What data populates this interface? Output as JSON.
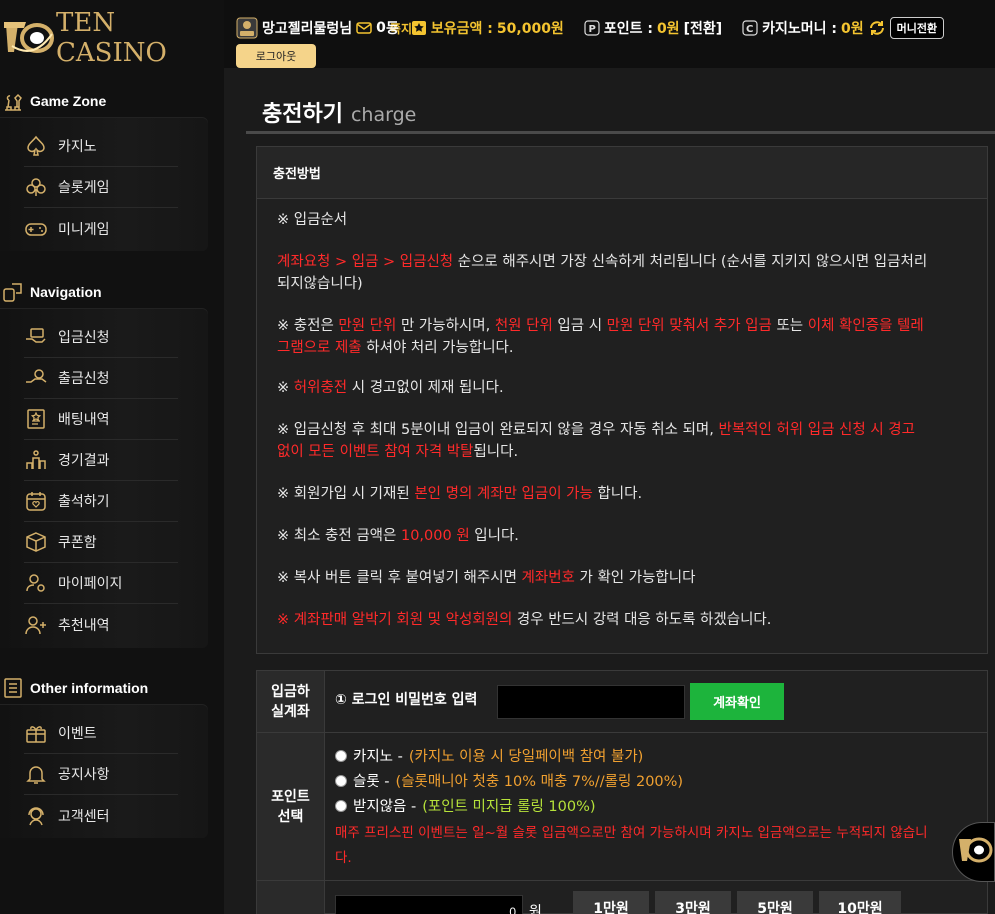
{
  "brand": {
    "name": "TEN CASINO"
  },
  "user": {
    "name": "망고젤리물렁님",
    "message_count": "0",
    "message_label": "쪽지",
    "mini_label": "등",
    "balance_label": "보유금액 :",
    "balance_value": "50,000원",
    "points_label": "포인트 :",
    "points_value": "0원",
    "points_convert": "[전환]",
    "casino_money_label": "카지노머니 :",
    "casino_money_value": "0원",
    "money_transfer": "머니전환",
    "logout": "로그아웃"
  },
  "sidebar": {
    "sections": [
      {
        "title": "Game Zone",
        "items": [
          {
            "label": "카지노",
            "icon": "spade-icon"
          },
          {
            "label": "슬롯게임",
            "icon": "club-icon"
          },
          {
            "label": "미니게임",
            "icon": "gamepad-icon"
          }
        ]
      },
      {
        "title": "Navigation",
        "items": [
          {
            "label": "입금신청",
            "icon": "deposit-icon"
          },
          {
            "label": "출금신청",
            "icon": "withdraw-icon"
          },
          {
            "label": "배팅내역",
            "icon": "betting-history-icon"
          },
          {
            "label": "경기결과",
            "icon": "results-icon"
          },
          {
            "label": "출석하기",
            "icon": "calendar-icon"
          },
          {
            "label": "쿠폰함",
            "icon": "coupon-box-icon"
          },
          {
            "label": "마이페이지",
            "icon": "user-settings-icon"
          },
          {
            "label": "추천내역",
            "icon": "referral-icon"
          }
        ]
      },
      {
        "title": "Other information",
        "items": [
          {
            "label": "이벤트",
            "icon": "gift-icon"
          },
          {
            "label": "공지사항",
            "icon": "bell-icon"
          },
          {
            "label": "고객센터",
            "icon": "support-icon"
          }
        ]
      }
    ]
  },
  "page": {
    "title_ko": "충전하기",
    "title_en": "charge"
  },
  "panel": {
    "heading": "충전방법",
    "order_title": "※ 입금순서",
    "n1a": "계좌요청 > 입금 > 입금신청",
    "n1b": " 순으로 해주시면 가장 신속하게 처리됩니다 (순서를 지키지 않으시면 입금처리",
    "n1c": "되지않습니다)",
    "n2a": "※ 충전은 ",
    "n2b": "만원 단위",
    "n2c": " 만 가능하시며, ",
    "n2d": "천원 단위",
    "n2e": " 입금 시 ",
    "n2f": "만원 단위 맞춰서 추가 입금",
    "n2g": " 또는 ",
    "n2h": "이체 확인증을 텔레",
    "n2i": "그램으로 제출",
    "n2j": " 하셔야 처리 가능합니다.",
    "n3a": "※ ",
    "n3b": "허위충전",
    "n3c": " 시 경고없이 제재 됩니다.",
    "n4a": "※ 입금신청 후 최대 5분이내 입금이 완료되지 않을 경우 자동 취소 되며, ",
    "n4b": "반복적인 허위 입금 신청 시 경고",
    "n4c": "없이 모든 이벤트 참여 자격 박탈",
    "n4d": "됩니다.",
    "n5a": "※ 회원가입 시 기재된 ",
    "n5b": "본인 명의 계좌만 입금이 가능",
    "n5c": " 합니다.",
    "n6a": "※ 최소 충전 금액은 ",
    "n6b": "10,000 원",
    "n6c": " 입니다.",
    "n7a": "※ 복사 버튼 클릭 후 붙여넣기 해주시면 ",
    "n7b": "계좌번호",
    "n7c": " 가 확인 가능합니다",
    "n8a": "※ ",
    "n8b": "계좌판매 알박기 회원 및 악성회원의",
    "n8c": " 경우 반드시 강력 대응 하도록 하겠습니다."
  },
  "form": {
    "account_head_1": "입금하",
    "account_head_2": "실계좌",
    "pw_label": "① 로그인 비밀번호 입력",
    "pw_value": "",
    "account_check": "계좌확인",
    "point_head_1": "포인트",
    "point_head_2": "선택",
    "opt1_label": "카지노 - ",
    "opt1_note": "(카지노 이용 시 당일페이백 참여 불가)",
    "opt2_label": "슬롯 - ",
    "opt2_note": "(슬롯매니아 첫충 10% 매충 7%//롤링 200%)",
    "opt3_label": "받지않음 - ",
    "opt3_note": "(포인트 미지급 롤링 100%)",
    "free_spin_1": "매주 프리스핀 이벤트는 일~월 슬롯 입금액으로만 참여 가능하시며 카지노 입금액으로는 누적되지 않습니",
    "free_spin_2": "다.",
    "amount_value": "0",
    "amount_unit": "원",
    "amt_buttons": [
      "1만원",
      "3만원",
      "5만원",
      "10만원"
    ]
  }
}
